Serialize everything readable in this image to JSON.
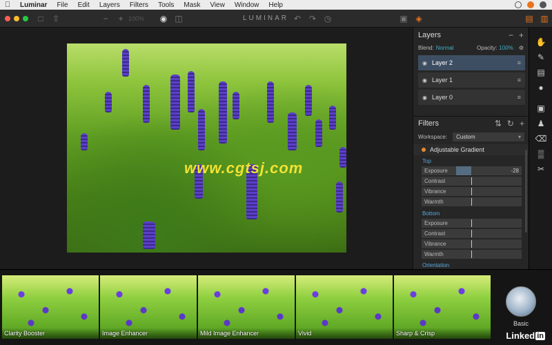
{
  "menubar": {
    "app": "Luminar",
    "items": [
      "File",
      "Edit",
      "Layers",
      "Filters",
      "Tools",
      "Mask",
      "View",
      "Window",
      "Help"
    ]
  },
  "toolbar": {
    "title": "LUMINAR",
    "zoom": "100%"
  },
  "watermark": "www.cgtsj.com",
  "layers": {
    "header": "Layers",
    "blend_label": "Blend:",
    "blend_value": "Normal",
    "opacity_label": "Opacity:",
    "opacity_value": "100%",
    "items": [
      {
        "label": "Layer 2",
        "selected": true
      },
      {
        "label": "Layer 1",
        "selected": false
      },
      {
        "label": "Layer 0",
        "selected": false
      }
    ]
  },
  "filters": {
    "header": "Filters",
    "workspace_label": "Workspace:",
    "workspace_value": "Custom",
    "filter_name": "Adjustable Gradient",
    "top_label": "Top",
    "bottom_label": "Bottom",
    "orientation_label": "Orientation",
    "top_sliders": [
      {
        "label": "Exposure",
        "value": "-28"
      },
      {
        "label": "Contrast",
        "value": ""
      },
      {
        "label": "Vibrance",
        "value": ""
      },
      {
        "label": "Warmth",
        "value": ""
      }
    ],
    "bottom_sliders": [
      {
        "label": "Exposure",
        "value": ""
      },
      {
        "label": "Contrast",
        "value": ""
      },
      {
        "label": "Vibrance",
        "value": ""
      },
      {
        "label": "Warmth",
        "value": ""
      }
    ]
  },
  "presets": [
    {
      "label": "Clarity Booster"
    },
    {
      "label": "Image Enhancer"
    },
    {
      "label": "Mild Image Enhancer"
    },
    {
      "label": "Vivid"
    },
    {
      "label": "Sharp & Crisp"
    }
  ],
  "preset_category": "Basic",
  "brand": {
    "text": "Linked",
    "badge": "in"
  },
  "colors": {
    "accent": "#e8741d",
    "selection": "#3e4e62",
    "link": "#3fb0c8"
  }
}
